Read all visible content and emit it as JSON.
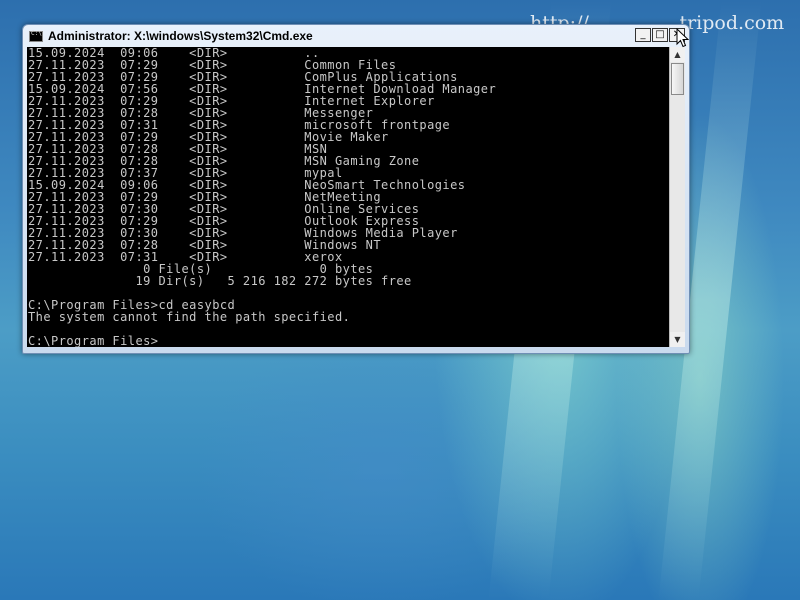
{
  "wallpaper": {
    "overlay_text": "http://...............tripod.com"
  },
  "window": {
    "title": "Administrator: X:\\windows\\System32\\Cmd.exe",
    "buttons": {
      "minimize": "_",
      "maximize": "□",
      "close": "✕"
    }
  },
  "console": {
    "lines": [
      "15.09.2024  09:06    <DIR>          ..",
      "27.11.2023  07:29    <DIR>          Common Files",
      "27.11.2023  07:29    <DIR>          ComPlus Applications",
      "15.09.2024  07:56    <DIR>          Internet Download Manager",
      "27.11.2023  07:29    <DIR>          Internet Explorer",
      "27.11.2023  07:28    <DIR>          Messenger",
      "27.11.2023  07:31    <DIR>          microsoft frontpage",
      "27.11.2023  07:29    <DIR>          Movie Maker",
      "27.11.2023  07:28    <DIR>          MSN",
      "27.11.2023  07:28    <DIR>          MSN Gaming Zone",
      "27.11.2023  07:37    <DIR>          mypal",
      "15.09.2024  09:06    <DIR>          NeoSmart Technologies",
      "27.11.2023  07:29    <DIR>          NetMeeting",
      "27.11.2023  07:30    <DIR>          Online Services",
      "27.11.2023  07:29    <DIR>          Outlook Express",
      "27.11.2023  07:30    <DIR>          Windows Media Player",
      "27.11.2023  07:28    <DIR>          Windows NT",
      "27.11.2023  07:31    <DIR>          xerox",
      "               0 File(s)              0 bytes",
      "              19 Dir(s)   5 216 182 272 bytes free",
      "",
      "C:\\Program Files>cd easybcd",
      "The system cannot find the path specified.",
      "",
      "C:\\Program Files>"
    ]
  },
  "scrollbar": {
    "up_arrow": "▲",
    "down_arrow": "▼"
  },
  "icons": {
    "window_icon": "cmd-icon",
    "cursor": "mouse-pointer-icon"
  }
}
